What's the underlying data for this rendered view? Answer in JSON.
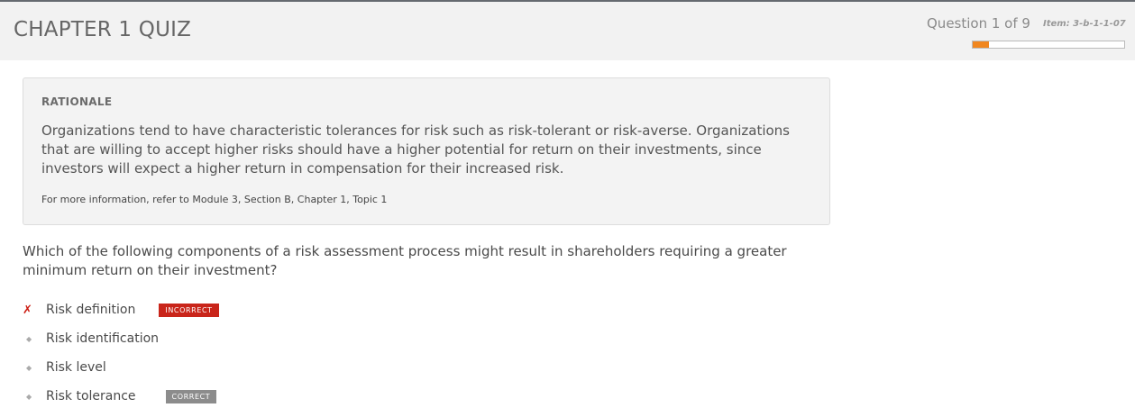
{
  "header": {
    "title": "CHAPTER 1 QUIZ",
    "progress_label": "Question 1 of 9",
    "item_code": "Item: 3-b-1-1-07",
    "progress_fraction": 0.11,
    "accent_color": "#f0861f"
  },
  "rationale": {
    "heading": "RATIONALE",
    "body": "Organizations tend to have characteristic tolerances for risk such as risk-tolerant or risk-averse. Organizations that are willing to accept higher risks should have a higher potential for return on their investments, since investors will expect a higher return in compensation for their increased risk.",
    "reference": "For more information, refer to Module 3, Section B, Chapter 1, Topic 1"
  },
  "question": {
    "text": "Which of the following components of a risk assessment process might result in shareholders requiring a greater minimum return on their investment?"
  },
  "options": [
    {
      "label": "Risk definition",
      "marker": "✗",
      "marker_icon": "x-mark-icon",
      "badge": "INCORRECT",
      "badge_color": "#c9251a"
    },
    {
      "label": "Risk identification",
      "marker": "◆",
      "marker_icon": "diamond-bullet-icon",
      "badge": ""
    },
    {
      "label": "Risk level",
      "marker": "◆",
      "marker_icon": "diamond-bullet-icon",
      "badge": ""
    },
    {
      "label": "Risk tolerance",
      "marker": "◆",
      "marker_icon": "diamond-bullet-icon",
      "badge": "CORRECT",
      "badge_color": "#8c8c8c"
    }
  ]
}
